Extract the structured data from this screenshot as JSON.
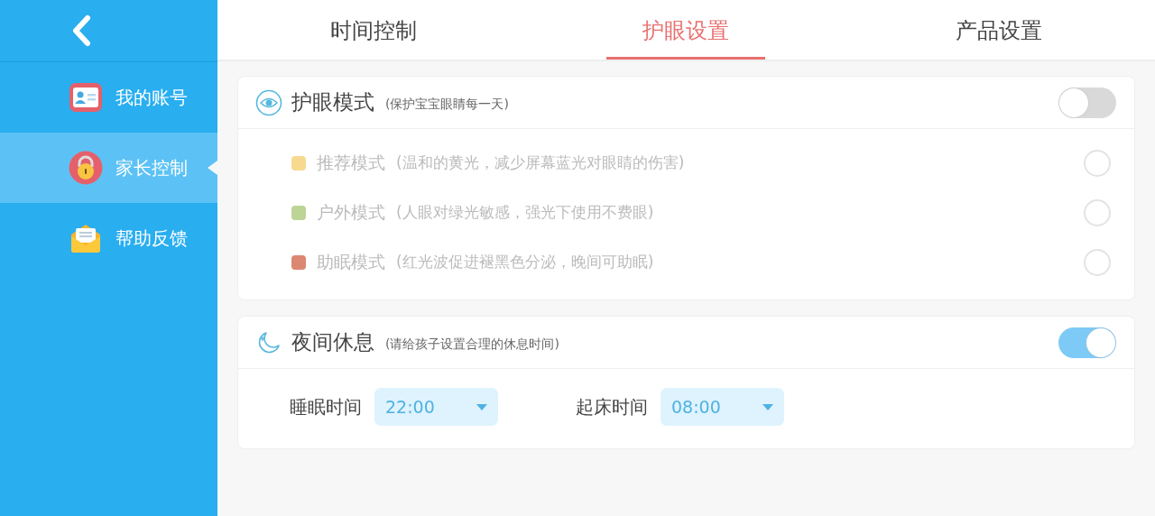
{
  "sidebar": {
    "items": [
      {
        "label": "我的账号",
        "kind": "card",
        "selected": false
      },
      {
        "label": "家长控制",
        "kind": "lock",
        "selected": true
      },
      {
        "label": "帮助反馈",
        "kind": "mail",
        "selected": false
      }
    ]
  },
  "tabs": [
    {
      "label": "时间控制",
      "selected": false
    },
    {
      "label": "护眼设置",
      "selected": true
    },
    {
      "label": "产品设置",
      "selected": false
    }
  ],
  "eye_care": {
    "title": "护眼模式",
    "subtitle": "(保护宝宝眼睛每一天)",
    "on": false,
    "modes": [
      {
        "name": "推荐模式",
        "description": "(温和的黄光，减少屏幕蓝光对眼睛的伤害)",
        "color": "#f7d990",
        "disabled": true,
        "selected": false
      },
      {
        "name": "户外模式",
        "description": "(人眼对绿光敏感，强光下使用不费眼)",
        "color": "#bcd496",
        "disabled": true,
        "selected": false
      },
      {
        "name": "助眠模式",
        "description": "(红光波促进褪黑色分泌，晚间可助眠)",
        "color": "#dc8772",
        "disabled": true,
        "selected": false
      }
    ]
  },
  "night_rest": {
    "title": "夜间休息",
    "subtitle": "(请给孩子设置合理的休息时间)",
    "on": true,
    "times": [
      {
        "label": "睡眠时间",
        "value": "22:00"
      },
      {
        "label": "起床时间",
        "value": "08:00"
      }
    ]
  }
}
